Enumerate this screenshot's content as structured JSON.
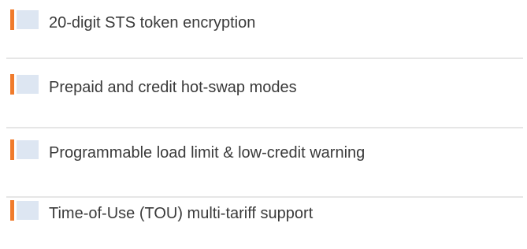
{
  "features": [
    {
      "label": "20-digit STS token encryption"
    },
    {
      "label": "Prepaid and credit hot-swap modes"
    },
    {
      "label": "Programmable load limit & low-credit warning"
    },
    {
      "label": "Time-of-Use (TOU) multi-tariff support"
    }
  ],
  "colors": {
    "accent": "#f07b2c",
    "box": "#dde6f2",
    "divider": "#e6e6e6",
    "text": "#3a3a3a"
  }
}
